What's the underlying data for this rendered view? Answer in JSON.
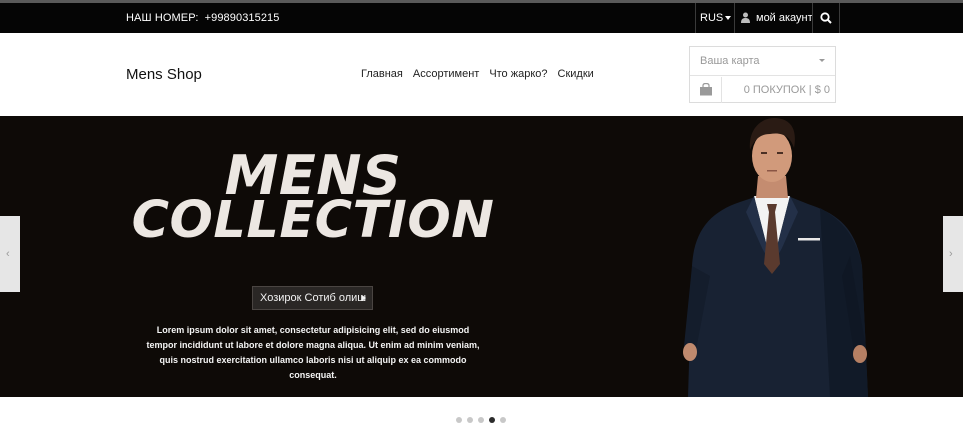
{
  "topbar": {
    "phone_label": "НАШ НОМЕР:",
    "phone_number": "+99890315215",
    "language": "RUS",
    "account_label": "мой акаунт"
  },
  "header": {
    "logo": "Mens Shop",
    "nav": [
      "Главная",
      "Ассортимент",
      "Что жарко?",
      "Скидки"
    ],
    "cart": {
      "select_label": "Ваша карта",
      "summary": "0 ПОКУПОК | $ 0"
    }
  },
  "hero": {
    "title_line1": "MENS",
    "title_line2": "COLLECTION",
    "cta_label": "Хозирок Сотиб олиш",
    "description": "Lorem ipsum dolor sit amet, consectetur adipisicing elit, sed do eiusmod tempor incididunt ut labore et dolore magna aliqua. Ut enim ad minim veniam, quis nostrud exercitation ullamco laboris nisi ut aliquip ex ea commodo consequat.",
    "prev_arrow": "‹",
    "next_arrow": "›"
  },
  "slider": {
    "total_slides": 5,
    "active_index": 4
  },
  "icons": [
    "user-icon",
    "search-icon",
    "shopping-bag-icon",
    "chevron-left-icon",
    "chevron-right-icon",
    "dropdown-caret-icon"
  ],
  "colors": {
    "topbar_bg": "#050505",
    "hero_bg": "#0e0a07",
    "headline": "#ece7e2",
    "cta_bg": "#2a2725",
    "dot_active": "#2b2b2b",
    "dot_inactive": "#c8c8c8"
  }
}
